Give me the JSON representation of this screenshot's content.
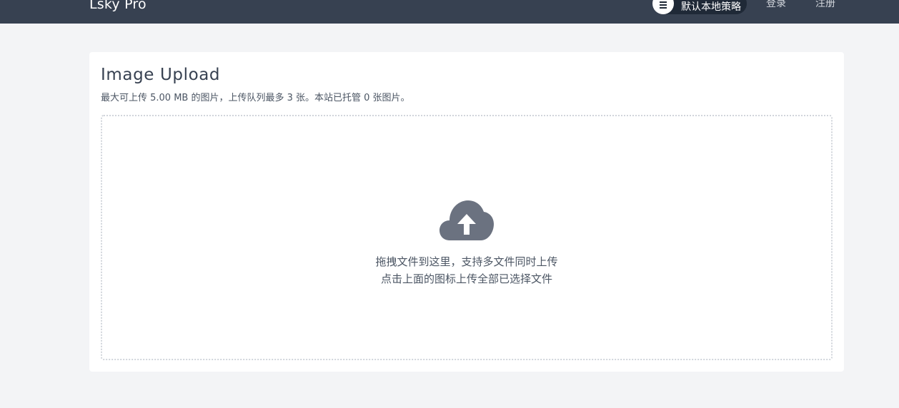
{
  "navbar": {
    "brand": "Lsky Pro",
    "strategy_label": "默认本地策略",
    "login_label": "登录",
    "register_label": "注册"
  },
  "upload": {
    "title": "Image Upload",
    "subtitle": "最大可上传 5.00 MB 的图片，上传队列最多 3 张。本站已托管 0 张图片。",
    "hint_line1": "拖拽文件到这里，支持多文件同时上传",
    "hint_line2": "点击上面的图标上传全部已选择文件",
    "icon": "cloud-upload-icon"
  },
  "colors": {
    "navbar_bg": "#374151",
    "page_bg": "#f3f4f6",
    "icon": "#6b7280"
  }
}
